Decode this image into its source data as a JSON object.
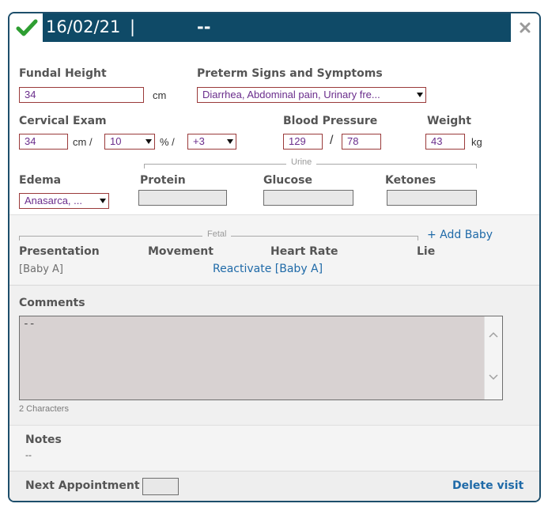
{
  "header": {
    "date": "16/02/21",
    "separator": "|",
    "value": "--",
    "check_icon": "check-icon",
    "close_icon": "close-icon"
  },
  "fundal": {
    "label": "Fundal Height",
    "value": "34",
    "unit": "cm"
  },
  "preterm": {
    "label": "Preterm Signs and Symptoms",
    "selected": "Diarrhea, Abdominal pain, Urinary fre..."
  },
  "cervical": {
    "label": "Cervical Exam",
    "value": "34",
    "unit_cm": "cm /",
    "effacement": "10",
    "percent": "% /",
    "station": "+3"
  },
  "bp": {
    "label": "Blood Pressure",
    "systolic": "129",
    "slash": "/",
    "diastolic": "78"
  },
  "weight": {
    "label": "Weight",
    "value": "43",
    "unit": "kg"
  },
  "urine": {
    "group_title": "Urine"
  },
  "edema": {
    "label": "Edema",
    "selected": "Anasarca, ..."
  },
  "protein": {
    "label": "Protein"
  },
  "glucose": {
    "label": "Glucose"
  },
  "ketones": {
    "label": "Ketones"
  },
  "fetal": {
    "group_title": "Fetal",
    "add_baby": "+ Add Baby",
    "presentation": "Presentation",
    "movement": "Movement",
    "heart_rate": "Heart Rate",
    "lie": "Lie",
    "baby": "[Baby A]",
    "reactivate": "Reactivate [Baby A]"
  },
  "comments": {
    "label": "Comments",
    "text": "--",
    "char_count": "2 Characters"
  },
  "notes": {
    "label": "Notes",
    "value": "--"
  },
  "footer": {
    "next_appointment": "Next Appointment",
    "delete_visit": "Delete visit"
  },
  "colors": {
    "header_bg": "#0f4a67",
    "check_green": "#2e9e32",
    "input_border": "#9a3a3a",
    "input_text": "#6a2d8c",
    "link_blue": "#1f6aa8"
  }
}
